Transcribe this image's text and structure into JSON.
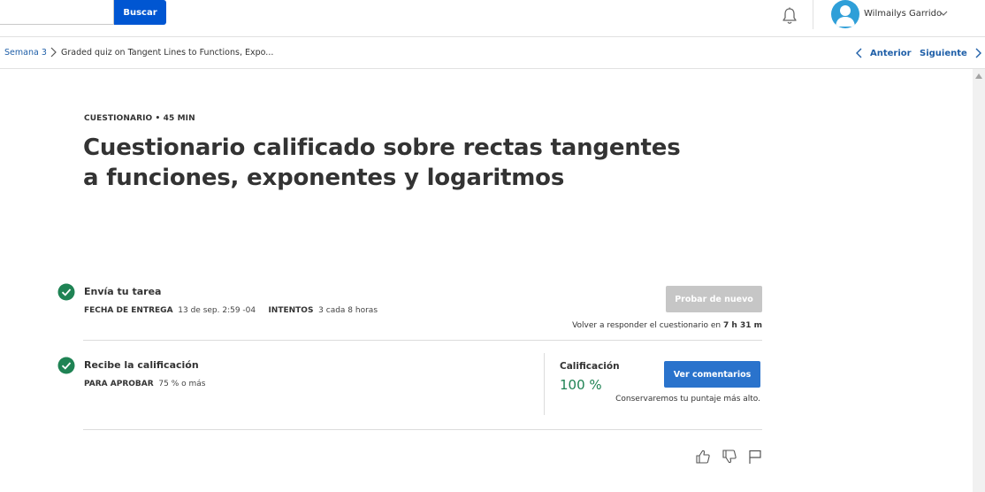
{
  "header": {
    "search": {
      "placeholder": "",
      "value": "",
      "button_label": "Buscar"
    },
    "notifications_icon": "bell-icon",
    "user": {
      "name": "Wilmailys Garrido",
      "avatar_icon": "user-avatar-icon",
      "menu_icon": "chevron-down-icon"
    }
  },
  "breadcrumb": {
    "parent": "Semana 3",
    "separator_icon": "chevron-right-icon",
    "current": "Graded quiz on Tangent Lines to Functions, Expo..."
  },
  "nav": {
    "previous_label": "Anterior",
    "next_label": "Siguiente"
  },
  "assignment": {
    "type_label": "CUESTIONARIO",
    "bullet": "•",
    "duration": "45 MIN",
    "title": "Cuestionario calificado sobre rectas tangentes a funciones, exponentes y logaritmos"
  },
  "submit_step": {
    "title": "Envía tu tarea",
    "due_label": "FECHA DE ENTREGA",
    "due_value": "13 de sep. 2:59 -04",
    "attempts_label": "INTENTOS",
    "attempts_value": "3 cada 8 horas",
    "retry_button": "Probar de nuevo",
    "retry_note_prefix": "Volver a responder el cuestionario en",
    "retry_note_time": "7 h 31 m"
  },
  "grade_step": {
    "title": "Recibe la calificación",
    "pass_label": "PARA APROBAR",
    "pass_value": "75 % o más",
    "grade_label": "Calificación",
    "grade_value": "100 %",
    "feedback_button": "Ver comentarios",
    "keep_note": "Conservaremos tu puntaje más alto."
  },
  "feedback_actions": [
    "like-icon",
    "dislike-icon",
    "flag-icon"
  ],
  "colors": {
    "primary": "#0056d2",
    "link": "#1f5fa8",
    "success": "#1f8354",
    "disabled": "#c6c6c6",
    "avatar": "#2f9fd8"
  }
}
